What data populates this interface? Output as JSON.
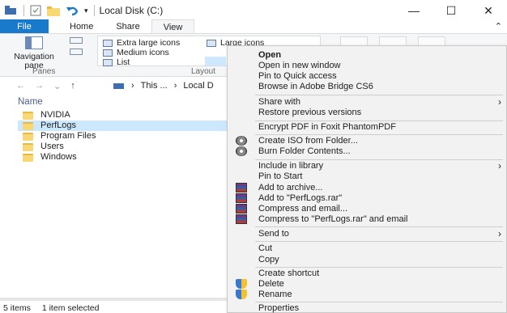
{
  "window": {
    "title": "Local Disk (C:)",
    "min": "—",
    "max": "☐",
    "close": "✕"
  },
  "tabs": {
    "file": "File",
    "home": "Home",
    "share": "Share",
    "view": "View"
  },
  "ribbon": {
    "nav_pane_label": "Navigation pane",
    "panes_group": "Panes",
    "layout_group": "Layout",
    "layout_items": [
      "Extra large icons",
      "Large icons",
      "Medium icons",
      "List"
    ]
  },
  "address": {
    "path": [
      "This ...",
      "Local D"
    ]
  },
  "files": {
    "column": "Name",
    "items": [
      "NVIDIA",
      "PerfLogs",
      "Program Files",
      "Users",
      "Windows"
    ],
    "selected": "PerfLogs"
  },
  "status": {
    "count": "5 items",
    "selection": "1 item selected"
  },
  "menu": {
    "open": "Open",
    "open_new_window": "Open in new window",
    "pin_quick": "Pin to Quick access",
    "bridge": "Browse in Adobe Bridge CS6",
    "share_with": "Share with",
    "restore": "Restore previous versions",
    "encrypt": "Encrypt PDF in Foxit PhantomPDF",
    "create_iso": "Create ISO from Folder...",
    "burn": "Burn Folder Contents...",
    "include_library": "Include in library",
    "pin_start": "Pin to Start",
    "add_archive": "Add to archive...",
    "add_rar": "Add to \"PerfLogs.rar\"",
    "compress_email": "Compress and email...",
    "compress_rar_email": "Compress to \"PerfLogs.rar\" and email",
    "send_to": "Send to",
    "cut": "Cut",
    "copy": "Copy",
    "create_shortcut": "Create shortcut",
    "delete": "Delete",
    "rename": "Rename",
    "properties": "Properties"
  }
}
